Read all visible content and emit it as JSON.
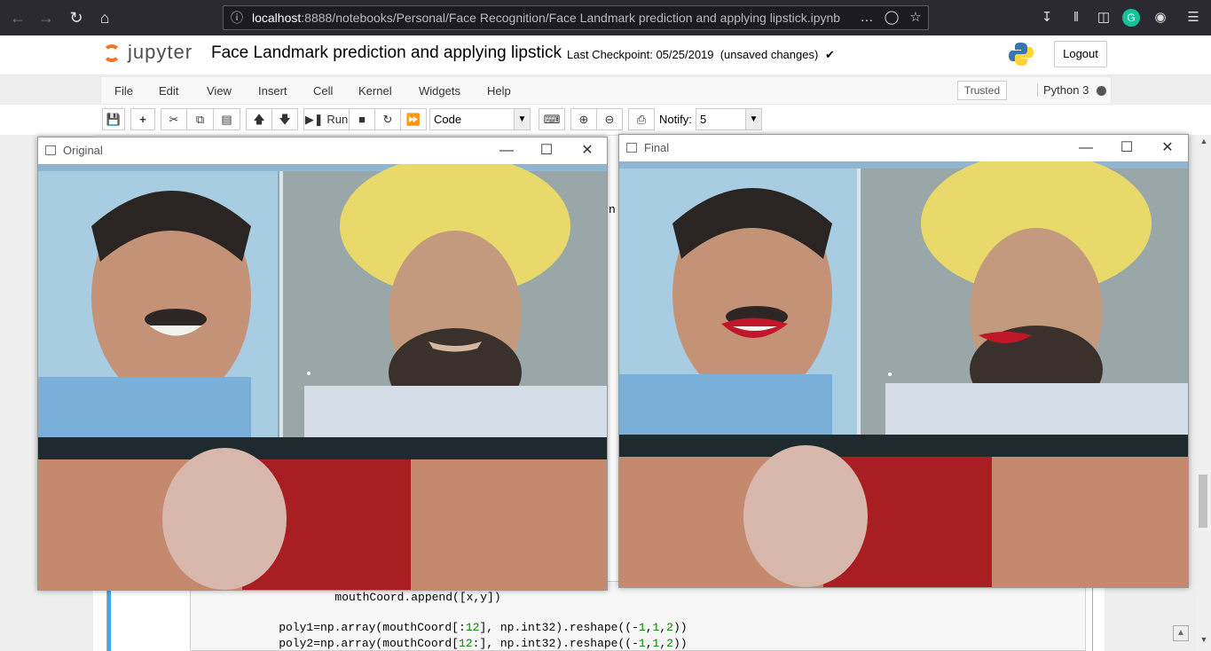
{
  "browser": {
    "url_host": "localhost",
    "url_rest": ":8888/notebooks/Personal/Face Recognition/Face Landmark prediction and applying lipstick.ipynb",
    "overflow_icon": "more-icon",
    "icons": [
      "back-icon",
      "forward-icon",
      "reload-icon",
      "home-icon",
      "info-icon",
      "pocket-icon",
      "star-icon",
      "download-icon",
      "library-icon",
      "sidebar-icon",
      "grammarly-icon",
      "account-icon",
      "menu-icon"
    ]
  },
  "header": {
    "logo_text": "jupyter",
    "title": "Face Landmark prediction and applying lipstick",
    "checkpoint": "Last Checkpoint: 05/25/2019  (unsaved changes)",
    "logout": "Logout"
  },
  "menubar": {
    "items": [
      "File",
      "Edit",
      "View",
      "Insert",
      "Cell",
      "Kernel",
      "Widgets",
      "Help"
    ],
    "trusted": "Trusted",
    "kernel": "Python 3"
  },
  "toolbar": {
    "run": "Run",
    "cell_type": "Code",
    "notify_label": "Notify:",
    "notify_value": "5"
  },
  "code": {
    "line1": "        mouthCoord.append([x,y])",
    "line2a": "    poly1=np.array(mouthCoord[:",
    "line2n": "12",
    "line2b": "], np.int32).reshape((-",
    "line2c": "1",
    "line2d": ",",
    "line2e": "1",
    "line2f": ",",
    "line2g": "2",
    "line2h": "))",
    "line3a": "    poly2=np.array(mouthCoord[",
    "line3n": "12",
    "line3b": ":], np.int32).reshape((-",
    "line3c": "1",
    "line3d": ",",
    "line3e": "1",
    "line3f": ",",
    "line3g": "2",
    "line3h": "))"
  },
  "windows": {
    "original_title": "Original",
    "final_title": "Final",
    "lipstick_color": "#c0182a"
  },
  "colors": {
    "browser_bg": "#2b2a33",
    "cell_bar": "#42a5f5",
    "turban": "#e8d96a"
  }
}
